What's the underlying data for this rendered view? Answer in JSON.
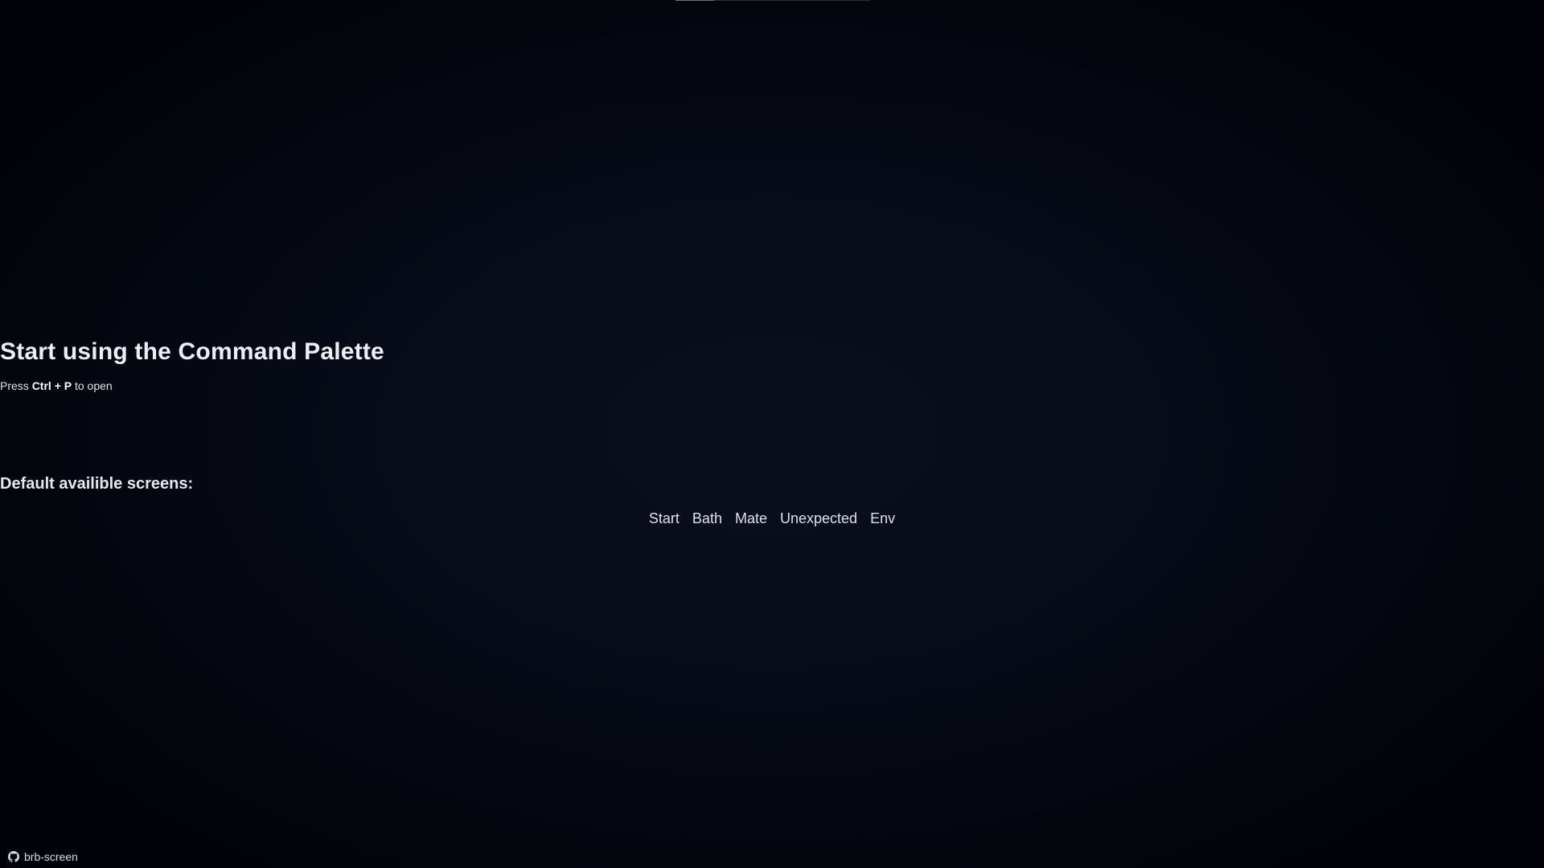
{
  "main": {
    "title": "Start using the Command Palette",
    "hint": {
      "prefix": "Press ",
      "shortcut": "Ctrl + P",
      "suffix": " to open"
    },
    "screens_heading": "Default availible screens:",
    "screens": [
      {
        "label": "Start"
      },
      {
        "label": "Bath"
      },
      {
        "label": "Mate"
      },
      {
        "label": "Unexpected"
      },
      {
        "label": "Env"
      }
    ]
  },
  "footer": {
    "icon": "github-icon",
    "label": "brb-screen"
  }
}
